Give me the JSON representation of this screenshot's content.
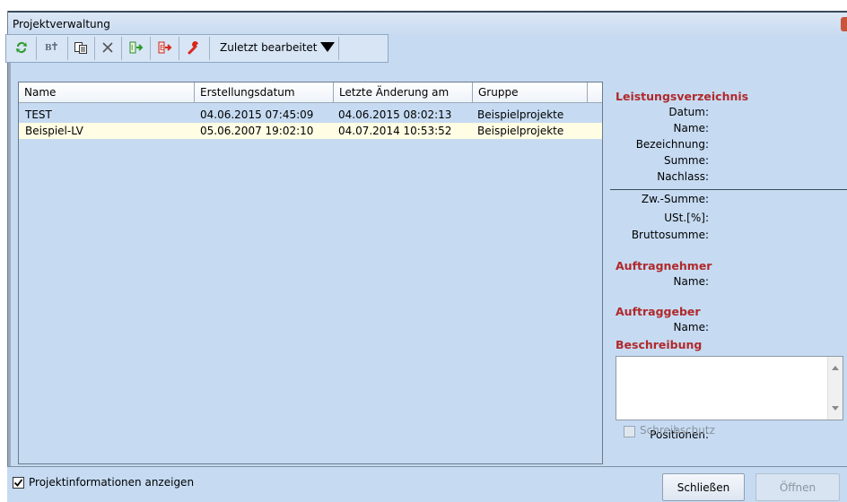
{
  "window": {
    "title": "Projektverwaltung"
  },
  "toolbar": {
    "icons": [
      "refresh-icon",
      "rename-icon",
      "copy-icon",
      "delete-icon",
      "import-icon",
      "export-icon",
      "tools-icon"
    ],
    "filter_label": "Zuletzt bearbeitet"
  },
  "table": {
    "columns": [
      "Name",
      "Erstellungsdatum",
      "Letzte Änderung am",
      "Gruppe"
    ],
    "rows": [
      {
        "name": "TEST",
        "created": "04.06.2015 07:45:09",
        "modified": "04.06.2015 08:02:13",
        "group": "Beispielprojekte"
      },
      {
        "name": "Beispiel-LV",
        "created": "05.06.2007 19:02:10",
        "modified": "04.07.2014 10:53:52",
        "group": "Beispielprojekte"
      }
    ]
  },
  "info": {
    "lv_title": "Leistungsverzeichnis",
    "labels": {
      "datum": "Datum:",
      "name": "Name:",
      "bezeichnung": "Bezeichnung:",
      "summe": "Summe:",
      "nachlass": "Nachlass:",
      "zw_summe": "Zw.-Summe:",
      "ust": "USt.[%]:",
      "brutto": "Bruttosumme:"
    },
    "auftragnehmer_title": "Auftragnehmer",
    "auftragnehmer_name": "Name:",
    "auftraggeber_title": "Auftraggeber",
    "auftraggeber_name": "Name:",
    "beschreibung_title": "Beschreibung",
    "positionen": "Positionen:",
    "schreibschutz": "Schreibschutz"
  },
  "footer": {
    "show_info_label": "Projektinformationen anzeigen",
    "close_button": "Schließen",
    "open_button": "Öffnen"
  },
  "colors": {
    "accent_red": "#b0292b",
    "panel_bg": "#c6dbf2",
    "selected_row": "#fffde3"
  }
}
